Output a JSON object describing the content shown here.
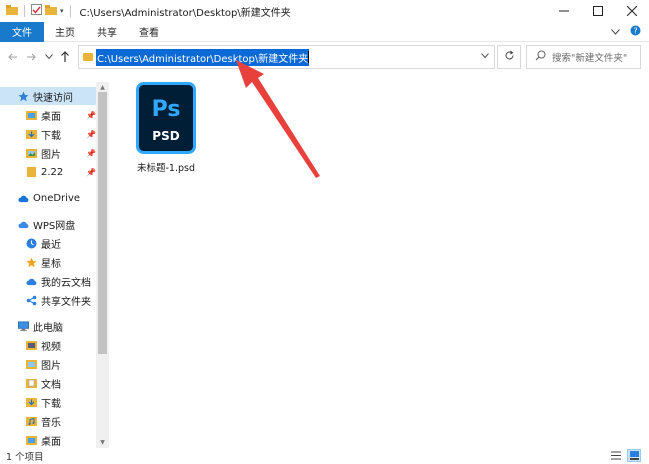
{
  "window": {
    "title": "C:\\Users\\Administrator\\Desktop\\新建文件夹"
  },
  "ribbon": {
    "tabs": [
      {
        "label": "文件"
      },
      {
        "label": "主页"
      },
      {
        "label": "共享"
      },
      {
        "label": "查看"
      }
    ]
  },
  "address": {
    "path": "C:\\Users\\Administrator\\Desktop\\新建文件夹"
  },
  "search": {
    "placeholder": "搜索\"新建文件夹\""
  },
  "sidebar": {
    "quick_access": {
      "label": "快速访问",
      "items": [
        {
          "label": "桌面",
          "pinned": true
        },
        {
          "label": "下载",
          "pinned": true
        },
        {
          "label": "图片",
          "pinned": true
        },
        {
          "label": "2.22",
          "pinned": true
        }
      ]
    },
    "onedrive": {
      "label": "OneDrive"
    },
    "wps": {
      "label": "WPS网盘",
      "items": [
        {
          "label": "最近"
        },
        {
          "label": "星标"
        },
        {
          "label": "我的云文档"
        },
        {
          "label": "共享文件夹"
        }
      ]
    },
    "this_pc": {
      "label": "此电脑",
      "items": [
        {
          "label": "视频"
        },
        {
          "label": "图片"
        },
        {
          "label": "文档"
        },
        {
          "label": "下载"
        },
        {
          "label": "音乐"
        },
        {
          "label": "桌面"
        }
      ]
    }
  },
  "files": [
    {
      "name": "未标题-1.psd",
      "icon_text": "Ps",
      "icon_sub": "PSD"
    }
  ],
  "status": {
    "item_count": "1 个项目"
  },
  "colors": {
    "accent": "#1979ca",
    "selection": "#0c6ad6",
    "ps_bg": "#001e36",
    "ps_blue": "#31a8ff",
    "annotation_arrow": "#e8413c"
  }
}
